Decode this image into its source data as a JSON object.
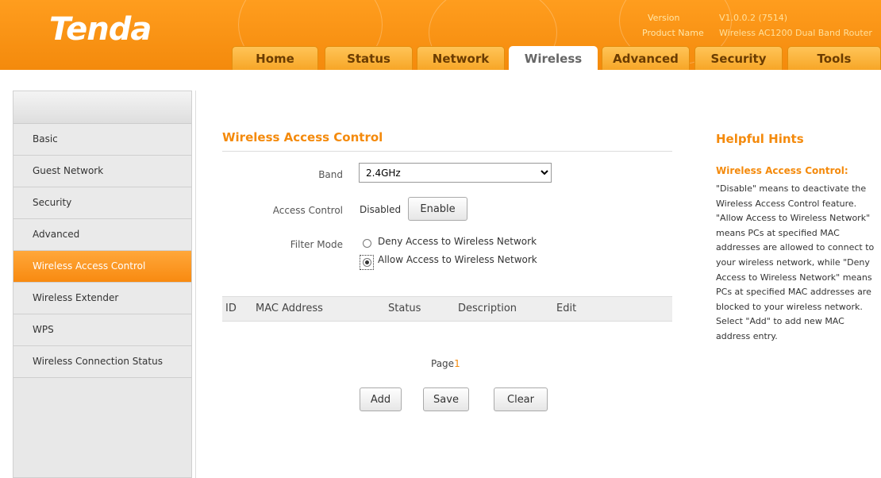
{
  "brand": {
    "logo": "Tenda"
  },
  "version_info": {
    "version_label": "Version",
    "version_value": "V1.0.0.2 (7514)",
    "product_label": "Product Name",
    "product_value": "Wireless AC1200 Dual Band Router"
  },
  "tabs": [
    "Home",
    "Status",
    "Network",
    "Wireless",
    "Advanced",
    "Security",
    "Tools"
  ],
  "active_tab": "Wireless",
  "sidebar": {
    "items": [
      "Basic",
      "Guest Network",
      "Security",
      "Advanced",
      "Wireless Access Control",
      "Wireless Extender",
      "WPS",
      "Wireless Connection Status"
    ],
    "active": "Wireless Access Control"
  },
  "main": {
    "title": "Wireless Access Control",
    "band_label": "Band",
    "band_value": "2.4GHz",
    "access_control_label": "Access Control",
    "access_control_status": "Disabled",
    "enable_button": "Enable",
    "filter_mode_label": "Filter Mode",
    "filter_options": [
      "Deny Access to Wireless Network",
      "Allow Access to Wireless Network"
    ],
    "filter_selected": "Allow Access to Wireless Network",
    "table_headers": [
      "ID",
      "MAC Address",
      "Status",
      "Description",
      "Edit"
    ],
    "page_label": "Page",
    "page_number": "1",
    "buttons": {
      "add": "Add",
      "save": "Save",
      "clear": "Clear"
    }
  },
  "hints": {
    "title": "Helpful Hints",
    "subtitle": "Wireless Access Control:",
    "body": "\"Disable\" means to deactivate the Wireless Access Control feature. \"Allow Access to Wireless Network\" means PCs at specified MAC addresses are allowed to connect to your wireless network, while \"Deny Access to Wireless Network\" means PCs at specified MAC addresses are blocked to your wireless network. Select \"Add\" to add new MAC address entry."
  },
  "colors": {
    "accent": "#f48a0c",
    "header_bg": "#f7900f"
  }
}
